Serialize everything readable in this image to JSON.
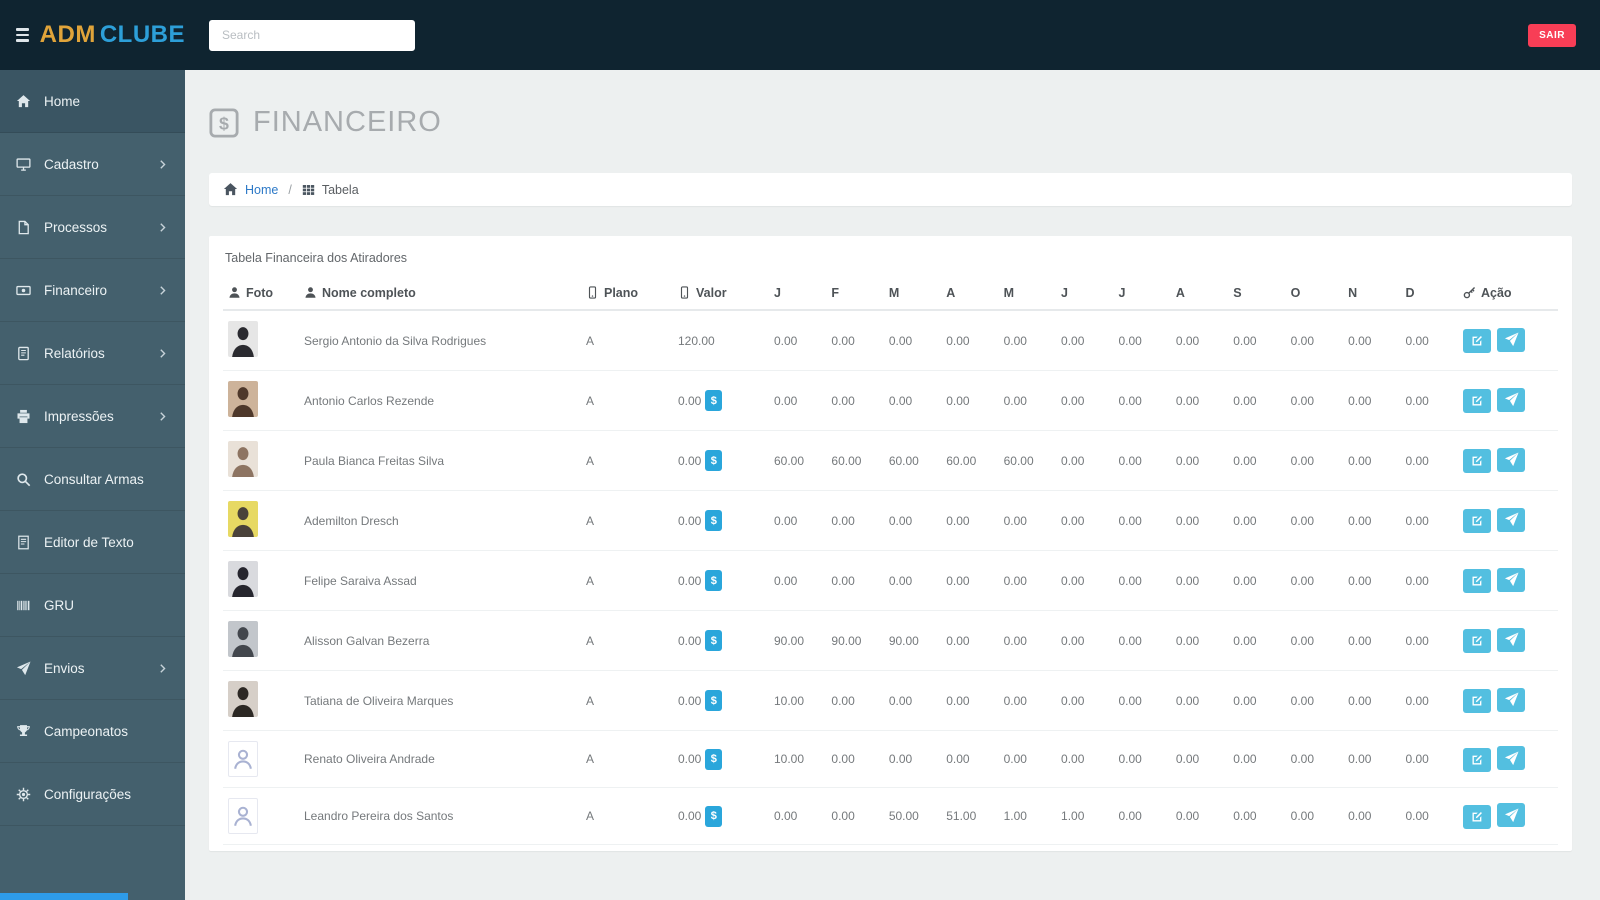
{
  "navbar": {
    "brand_adm": "ADM",
    "brand_clube": "CLUBE",
    "search_placeholder": "Search",
    "logout_label": "SAIR"
  },
  "sidebar": {
    "items": [
      {
        "label": "Home",
        "icon": "home-icon",
        "has_submenu": false,
        "active": true
      },
      {
        "label": "Cadastro",
        "icon": "desktop-icon",
        "has_submenu": true,
        "active": false
      },
      {
        "label": "Processos",
        "icon": "file-icon",
        "has_submenu": true,
        "active": false
      },
      {
        "label": "Financeiro",
        "icon": "money-icon",
        "has_submenu": true,
        "active": false
      },
      {
        "label": "Relatórios",
        "icon": "book-icon",
        "has_submenu": true,
        "active": false
      },
      {
        "label": "Impressões",
        "icon": "printer-icon",
        "has_submenu": true,
        "active": false
      },
      {
        "label": "Consultar Armas",
        "icon": "search-icon",
        "has_submenu": false,
        "active": false
      },
      {
        "label": "Editor de Texto",
        "icon": "document-icon",
        "has_submenu": false,
        "active": false
      },
      {
        "label": "GRU",
        "icon": "barcode-icon",
        "has_submenu": false,
        "active": false
      },
      {
        "label": "Envios",
        "icon": "send-icon",
        "has_submenu": true,
        "active": false
      },
      {
        "label": "Campeonatos",
        "icon": "trophy-icon",
        "has_submenu": false,
        "active": false
      },
      {
        "label": "Configurações",
        "icon": "gear-icon",
        "has_submenu": false,
        "active": false
      }
    ]
  },
  "page": {
    "title": "FINANCEIRO",
    "breadcrumb_home": "Home",
    "breadcrumb_separator": "/",
    "breadcrumb_current": "Tabela",
    "panel_title": "Tabela Financeira dos Atiradores"
  },
  "colors": {
    "navbar_bg": "#0f2430",
    "sidebar_bg": "#44606d",
    "brand_gold": "#e0a43a",
    "brand_blue": "#2d9fd8",
    "danger_red": "#f83e56",
    "action_blue": "#53bfe0",
    "badge_blue": "#2aa6db"
  },
  "table": {
    "dollar_symbol": "$",
    "columns": [
      {
        "label": "Foto",
        "icon": "user-icon"
      },
      {
        "label": "Nome completo",
        "icon": "user-icon"
      },
      {
        "label": "Plano",
        "icon": "mobile-icon"
      },
      {
        "label": "Valor",
        "icon": "mobile-icon"
      },
      {
        "label": "J"
      },
      {
        "label": "F"
      },
      {
        "label": "M"
      },
      {
        "label": "A"
      },
      {
        "label": "M"
      },
      {
        "label": "J"
      },
      {
        "label": "J"
      },
      {
        "label": "A"
      },
      {
        "label": "S"
      },
      {
        "label": "O"
      },
      {
        "label": "N"
      },
      {
        "label": "D"
      },
      {
        "label": "Ação",
        "icon": "key-icon"
      }
    ],
    "rows": [
      {
        "name": "Sergio Antonio da Silva Rodrigues",
        "plano": "A",
        "valor": "120.00",
        "dollar_badge": false,
        "months": [
          "0.00",
          "0.00",
          "0.00",
          "0.00",
          "0.00",
          "0.00",
          "0.00",
          "0.00",
          "0.00",
          "0.00",
          "0.00",
          "0.00"
        ],
        "avatar": {
          "kind": "photo",
          "bg": "#e6e6e6",
          "fg": "#2b2b30"
        }
      },
      {
        "name": "Antonio Carlos Rezende",
        "plano": "A",
        "valor": "0.00",
        "dollar_badge": true,
        "months": [
          "0.00",
          "0.00",
          "0.00",
          "0.00",
          "0.00",
          "0.00",
          "0.00",
          "0.00",
          "0.00",
          "0.00",
          "0.00",
          "0.00"
        ],
        "avatar": {
          "kind": "photo",
          "bg": "#cdb39a",
          "fg": "#4e382a"
        }
      },
      {
        "name": "Paula Bianca Freitas Silva",
        "plano": "A",
        "valor": "0.00",
        "dollar_badge": true,
        "months": [
          "60.00",
          "60.00",
          "60.00",
          "60.00",
          "60.00",
          "0.00",
          "0.00",
          "0.00",
          "0.00",
          "0.00",
          "0.00",
          "0.00"
        ],
        "avatar": {
          "kind": "photo",
          "bg": "#e9e1d8",
          "fg": "#8d7462"
        }
      },
      {
        "name": "Ademilton Dresch",
        "plano": "A",
        "valor": "0.00",
        "dollar_badge": true,
        "months": [
          "0.00",
          "0.00",
          "0.00",
          "0.00",
          "0.00",
          "0.00",
          "0.00",
          "0.00",
          "0.00",
          "0.00",
          "0.00",
          "0.00"
        ],
        "avatar": {
          "kind": "photo",
          "bg": "#e7d963",
          "fg": "#4a423a"
        }
      },
      {
        "name": "Felipe Saraiva Assad",
        "plano": "A",
        "valor": "0.00",
        "dollar_badge": true,
        "months": [
          "0.00",
          "0.00",
          "0.00",
          "0.00",
          "0.00",
          "0.00",
          "0.00",
          "0.00",
          "0.00",
          "0.00",
          "0.00",
          "0.00"
        ],
        "avatar": {
          "kind": "photo",
          "bg": "#d9dade",
          "fg": "#26262e"
        }
      },
      {
        "name": "Alisson Galvan Bezerra",
        "plano": "A",
        "valor": "0.00",
        "dollar_badge": true,
        "months": [
          "90.00",
          "90.00",
          "90.00",
          "0.00",
          "0.00",
          "0.00",
          "0.00",
          "0.00",
          "0.00",
          "0.00",
          "0.00",
          "0.00"
        ],
        "avatar": {
          "kind": "photo",
          "bg": "#c2c6cb",
          "fg": "#43474d"
        }
      },
      {
        "name": "Tatiana de Oliveira Marques",
        "plano": "A",
        "valor": "0.00",
        "dollar_badge": true,
        "months": [
          "10.00",
          "0.00",
          "0.00",
          "0.00",
          "0.00",
          "0.00",
          "0.00",
          "0.00",
          "0.00",
          "0.00",
          "0.00",
          "0.00"
        ],
        "avatar": {
          "kind": "photo",
          "bg": "#d6cfc8",
          "fg": "#2c2824"
        }
      },
      {
        "name": "Renato Oliveira Andrade",
        "plano": "A",
        "valor": "0.00",
        "dollar_badge": true,
        "months": [
          "10.00",
          "0.00",
          "0.00",
          "0.00",
          "0.00",
          "0.00",
          "0.00",
          "0.00",
          "0.00",
          "0.00",
          "0.00",
          "0.00"
        ],
        "avatar": {
          "kind": "placeholder"
        }
      },
      {
        "name": "Leandro Pereira dos Santos",
        "plano": "A",
        "valor": "0.00",
        "dollar_badge": true,
        "months": [
          "0.00",
          "0.00",
          "50.00",
          "51.00",
          "1.00",
          "1.00",
          "0.00",
          "0.00",
          "0.00",
          "0.00",
          "0.00",
          "0.00"
        ],
        "avatar": {
          "kind": "placeholder"
        }
      }
    ]
  }
}
